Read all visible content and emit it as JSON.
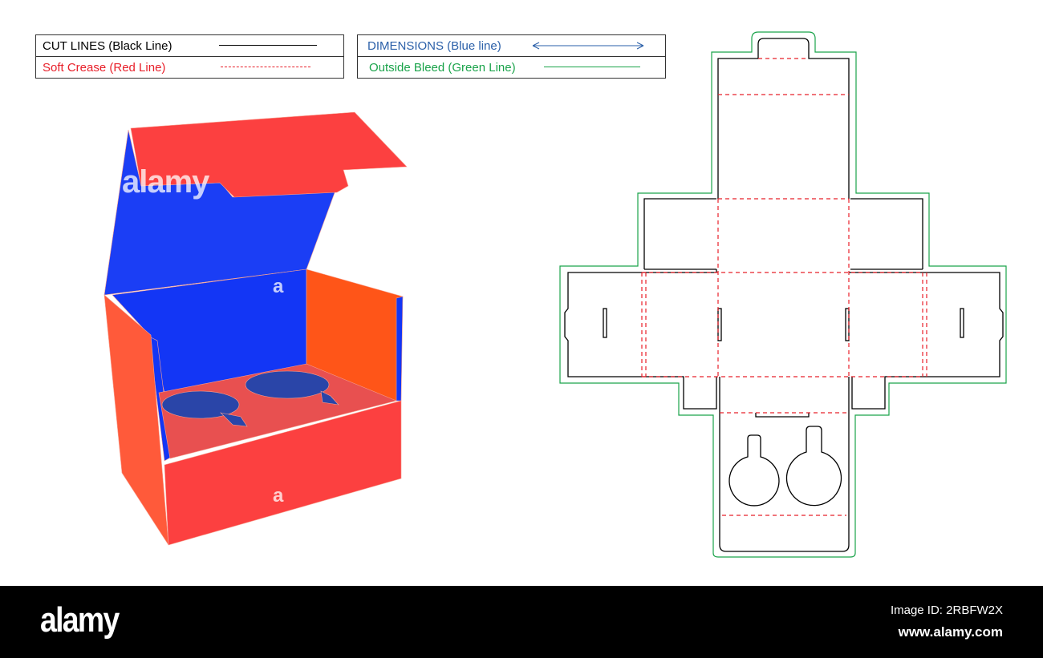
{
  "legend": {
    "cut_lines": "CUT LINES (Black Line)",
    "soft_crease": "Soft Crease (Red Line)",
    "dimensions": "DIMENSIONS (Blue line)",
    "outside_bleed": "Outside Bleed (Green Line)"
  },
  "colors": {
    "cut": "#000000",
    "crease": "#e8202a",
    "dimension": "#2a5fa8",
    "bleed": "#1aa34a",
    "box_red": "#fc4040",
    "box_blue": "#1336f5",
    "box_orange": "#ff5518"
  },
  "watermark": {
    "main": "alamy",
    "small": "a"
  },
  "footer": {
    "logo": "alamy",
    "image_id": "Image ID: 2RBFW2X",
    "url": "www.alamy.com"
  }
}
